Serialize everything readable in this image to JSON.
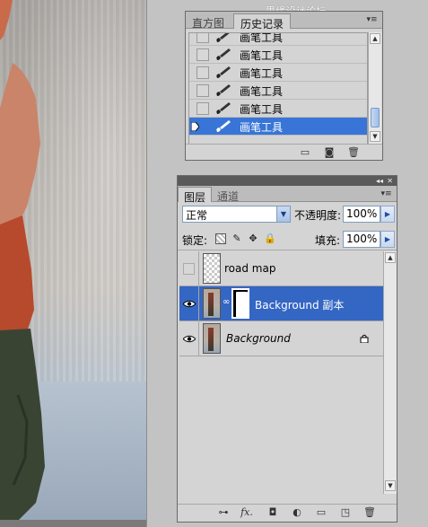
{
  "watermark": "思缘设计论坛 www.MISSYUAN.COM",
  "history_panel": {
    "tabs": [
      "直方图",
      "历史记录"
    ],
    "active_tab": 1,
    "menu_icon": "panel-menu-icon",
    "items": [
      {
        "label": "画笔工具",
        "selected": false
      },
      {
        "label": "画笔工具",
        "selected": false
      },
      {
        "label": "画笔工具",
        "selected": false
      },
      {
        "label": "画笔工具",
        "selected": false
      },
      {
        "label": "画笔工具",
        "selected": false
      },
      {
        "label": "画笔工具",
        "selected": true
      }
    ],
    "footer_icons": [
      "new-document-from-state-icon",
      "new-snapshot-icon",
      "delete-state-icon"
    ]
  },
  "layers_panel": {
    "tabs": [
      "图层",
      "通道"
    ],
    "active_tab": 0,
    "blend_mode": "正常",
    "opacity_label": "不透明度:",
    "opacity_value": "100%",
    "lock_label": "锁定:",
    "lock_icons": [
      "lock-transparent-icon",
      "lock-image-icon",
      "lock-position-icon",
      "lock-all-icon"
    ],
    "fill_label": "填充:",
    "fill_value": "100%",
    "layers": [
      {
        "name": "road map",
        "visible": false,
        "selected": false,
        "thumbnail": "transparent",
        "italic": false
      },
      {
        "name": "Background 副本",
        "visible": true,
        "selected": true,
        "thumbnail": "photo",
        "has_mask": true,
        "italic": false
      },
      {
        "name": "Background",
        "visible": true,
        "selected": false,
        "thumbnail": "photo",
        "locked": true,
        "italic": true
      }
    ],
    "footer_icons": [
      "link-layers-icon",
      "layer-style-icon",
      "add-mask-icon",
      "adjustment-layer-icon",
      "new-group-icon",
      "new-layer-icon",
      "delete-layer-icon"
    ],
    "footer_glyph_fx": "fx.",
    "colors": {
      "selection": "#3466c4",
      "panel_bg": "#d4d4d4"
    }
  }
}
